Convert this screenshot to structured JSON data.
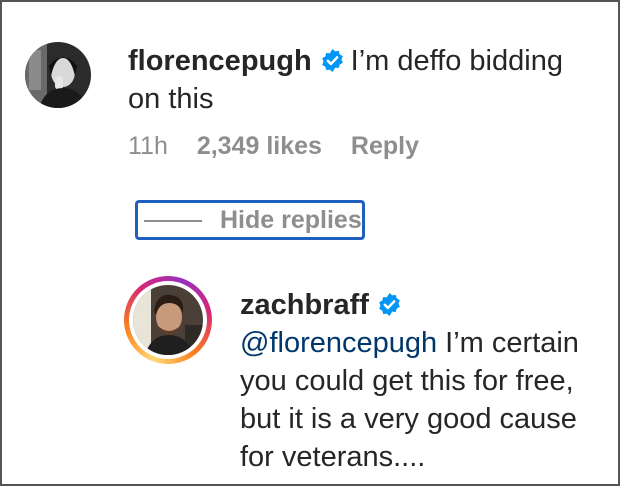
{
  "comment": {
    "username": "florencepugh",
    "text": "I’m deffo bidding on this",
    "time": "11h",
    "likes": "2,349 likes",
    "reply_label": "Reply",
    "verified_icon": "verified-badge-icon"
  },
  "replies_toggle": {
    "label": "Hide replies"
  },
  "reply": {
    "username": "zachbraff",
    "mention": "@florencepugh",
    "text": " I’m certain you could get this for free, but it is a very good cause for veterans....",
    "verified_icon": "verified-badge-icon"
  },
  "colors": {
    "verified_blue": "#0095f6",
    "text": "#262626",
    "secondary_text": "#8e8e8e",
    "mention": "#00376b",
    "highlight_box": "#1f5fbf"
  }
}
